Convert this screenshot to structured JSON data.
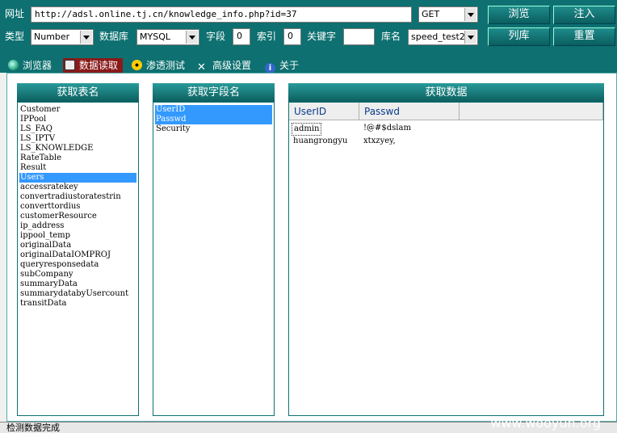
{
  "toolbar": {
    "url_label": "网址",
    "url_value": "http://adsl.online.tj.cn/knowledge_info.php?id=37",
    "method": "GET",
    "browse_button": "浏览",
    "inject_button": "注入",
    "type_label": "类型",
    "type_value": "Number",
    "db_label": "数据库",
    "db_value": "MYSQL",
    "field_label": "字段",
    "field_value": "0",
    "index_label": "索引",
    "index_value": "0",
    "keyword_label": "关键字",
    "keyword_value": "",
    "dbname_label": "库名",
    "dbname_value": "speed_test2",
    "list_db_button": "列库",
    "reset_button": "重置"
  },
  "tabs": [
    {
      "label": "浏览器",
      "icon": "globe-icon"
    },
    {
      "label": "数据读取",
      "icon": "database-icon",
      "active": true
    },
    {
      "label": "渗透测试",
      "icon": "radiation-icon"
    },
    {
      "label": "高级设置",
      "icon": "tools-icon"
    },
    {
      "label": "关于",
      "icon": "info-icon"
    }
  ],
  "panels": {
    "tables": {
      "title": "获取表名",
      "items": [
        "Customer",
        "IPPool",
        "LS_FAQ",
        "LS_IPTV",
        "LS_KNOWLEDGE",
        "RateTable",
        "Result",
        "Users",
        "accessratekey",
        "convertradiustoratestrin",
        "converttordius",
        "customerResource",
        "ip_address",
        "ippool_temp",
        "originalData",
        "originalDataIOMPROJ",
        "queryresponsedata",
        "subCompany",
        "summaryData",
        "summarydatabyUsercount",
        "transitData"
      ],
      "selected_index": 7
    },
    "fields": {
      "title": "获取字段名",
      "items": [
        "UserID",
        "Passwd",
        "Security"
      ],
      "selected_indices": [
        0,
        1
      ]
    },
    "data": {
      "title": "获取数据",
      "columns": [
        "UserID",
        "Passwd"
      ],
      "rows": [
        [
          "admin",
          "!@#$dslam"
        ],
        [
          "huangrongyu",
          "xtxzyey,"
        ]
      ]
    }
  },
  "status": {
    "text": "检测数据完成"
  },
  "watermark": "www.wooyun.org"
}
